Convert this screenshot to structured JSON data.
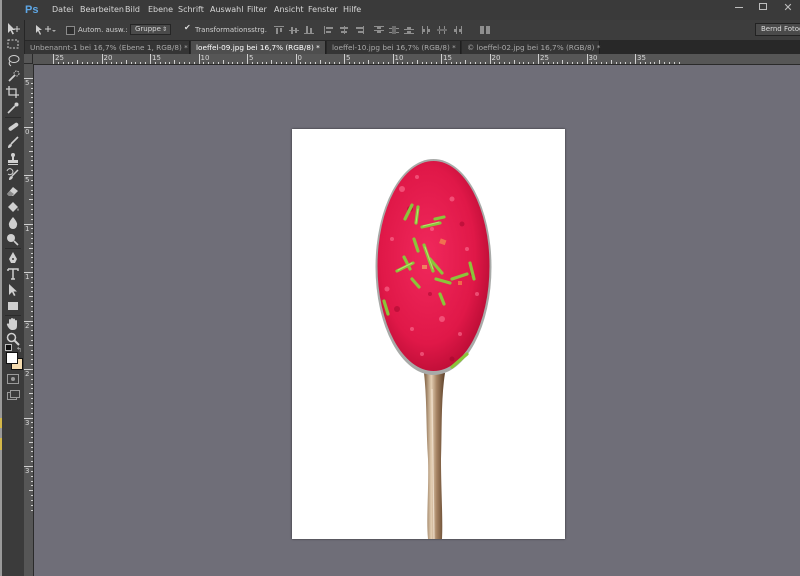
{
  "app": {
    "logo": "Ps",
    "menu": [
      "Datei",
      "Bearbeiten",
      "Bild",
      "Ebene",
      "Schrift",
      "Auswahl",
      "Filter",
      "Ansicht",
      "Fenster",
      "Hilfe"
    ]
  },
  "options_bar": {
    "auto_select_label": "Autom. ausw.:",
    "auto_select_checked": false,
    "auto_select_target": "Gruppe",
    "transform_label": "Transformationsstrg.",
    "transform_checked": true,
    "workspace": "Bernd Fotografie"
  },
  "tabs": [
    {
      "label": "Unbenannt-1 bei 16,7% (Ebene 1, RGB/8) *",
      "active": false
    },
    {
      "label": "loeffel-09.jpg bei 16,7% (RGB/8) *",
      "active": true
    },
    {
      "label": "loeffel-10.jpg bei 16,7% (RGB/8) *",
      "active": false
    },
    {
      "label": "© loeffel-02.jpg bei 16,7% (RGB/8) *",
      "active": false
    }
  ],
  "rulers": {
    "top_labels": [
      "25",
      "20",
      "15",
      "10",
      "5",
      "0",
      "5",
      "10",
      "15",
      "20",
      "25",
      "30",
      "35"
    ],
    "left_labels": [
      "5",
      "0",
      "5",
      "1",
      "1",
      "2",
      "2",
      "3",
      "3"
    ]
  },
  "tools": [
    "move-tool",
    "marquee-tool",
    "lasso-tool",
    "quick-select-tool",
    "crop-tool",
    "eyedropper-tool",
    "healing-brush-tool",
    "brush-tool",
    "clone-stamp-tool",
    "history-brush-tool",
    "eraser-tool",
    "paint-bucket-tool",
    "blur-tool",
    "dodge-tool",
    "pen-tool",
    "type-tool",
    "path-select-tool",
    "rectangle-tool",
    "hand-tool",
    "zoom-tool"
  ],
  "colors": {
    "foreground": "#ffffff",
    "background": "#f5dcb0",
    "pasteboard": "#6f6e78",
    "accent": "#5ea7e6"
  },
  "document": {
    "zoom": "16,7%",
    "content": "photo of a spoon filled with red beet puree topped with chopped chives on white background"
  }
}
